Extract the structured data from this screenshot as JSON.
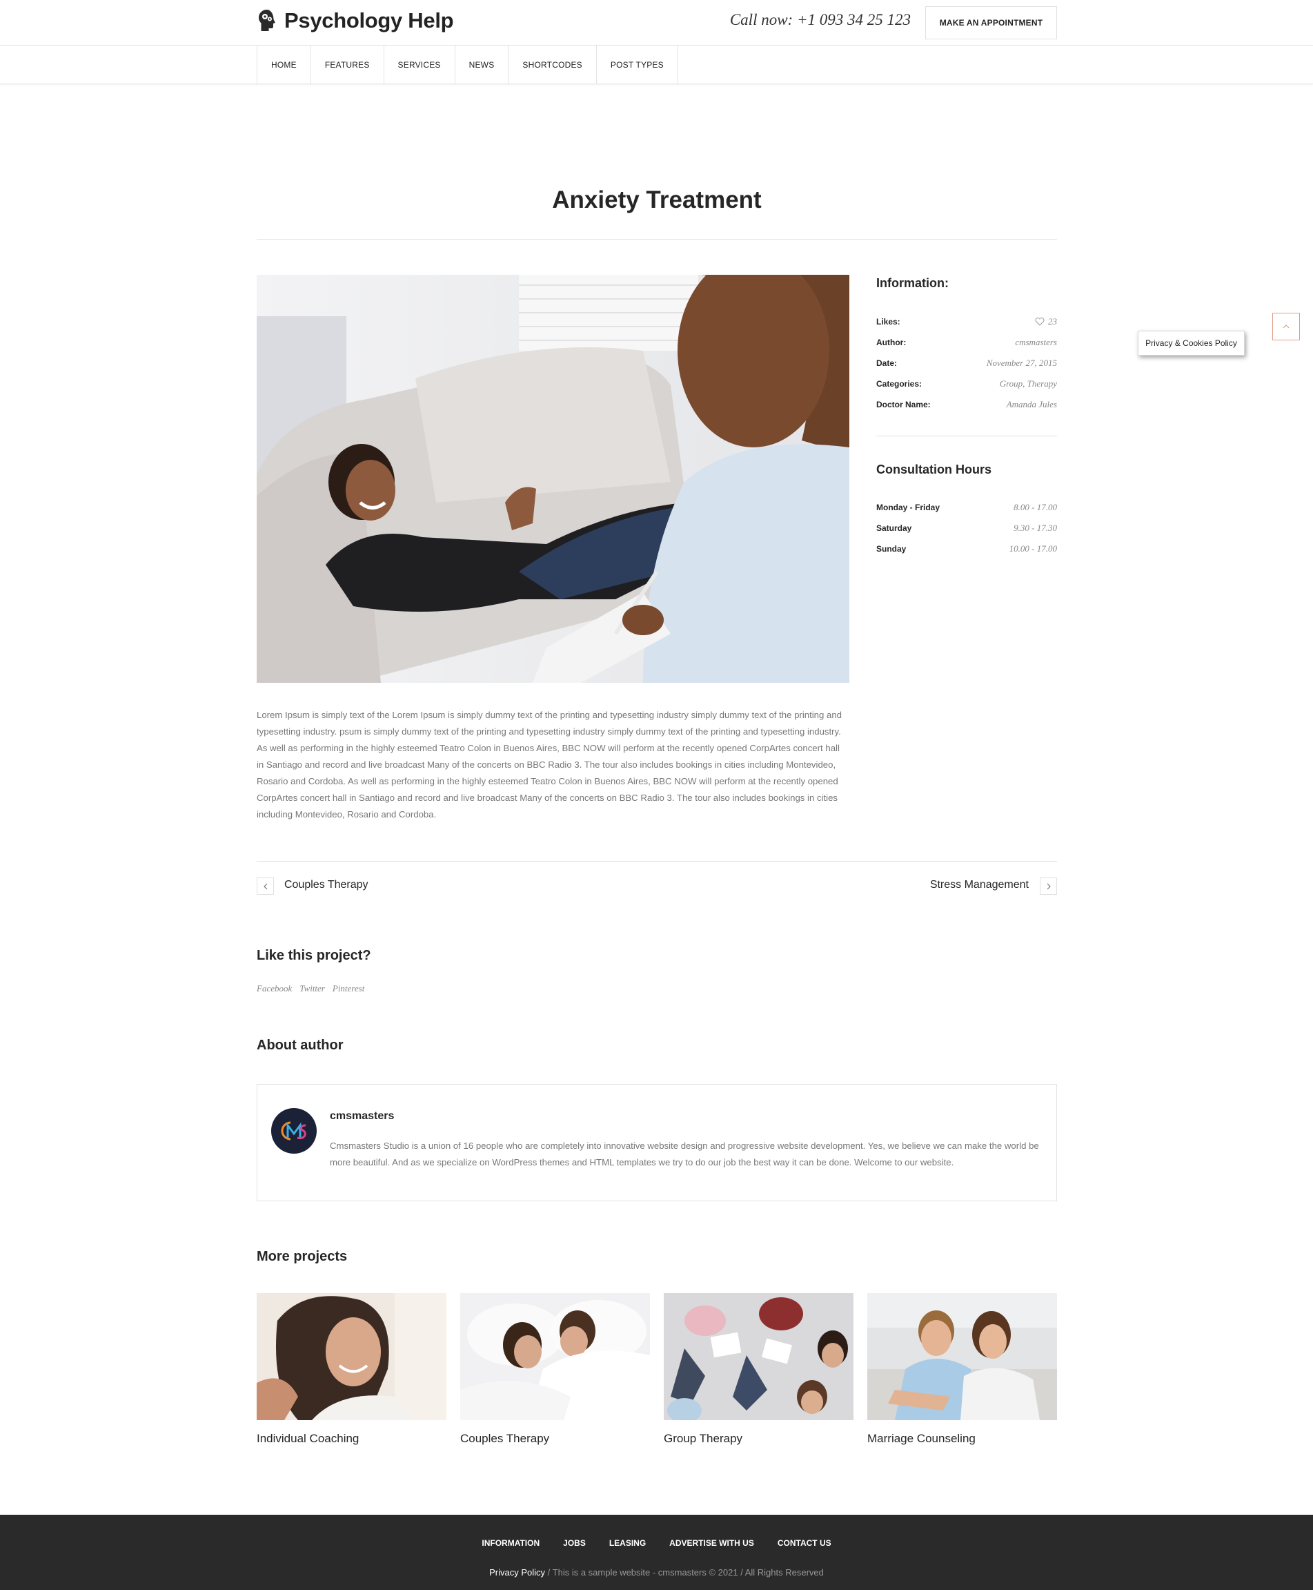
{
  "header": {
    "logo_text": "Psychology Help",
    "call_now": "Call now: +1 093 34 25 123",
    "appointment_label": "MAKE AN APPOINTMENT"
  },
  "nav": {
    "items": [
      {
        "label": "HOME"
      },
      {
        "label": "FEATURES"
      },
      {
        "label": "SERVICES"
      },
      {
        "label": "NEWS"
      },
      {
        "label": "SHORTCODES"
      },
      {
        "label": "POST TYPES"
      }
    ]
  },
  "page": {
    "title": "Anxiety Treatment",
    "body_text": "Lorem Ipsum is simply text of the Lorem Ipsum is  simply dummy text of the printing and typesetting industry simply dummy text of the printing and typesetting industry. psum is  simply dummy text of the printing and typesetting industry simply dummy text of the printing and typesetting industry.  As well as performing in the highly esteemed Teatro Colon in Buenos Aires, BBC NOW will perform at the recently opened CorpArtes concert hall in Santiago and record and live broadcast Many of the concerts on BBC Radio 3. The tour also includes bookings in cities including Montevideo, Rosario and Cordoba. As well as performing in the highly esteemed Teatro Colon in Buenos Aires, BBC NOW will perform at the recently opened CorpArtes concert hall in Santiago and record and live broadcast Many of the concerts on BBC Radio 3. The tour also includes bookings in cities including Montevideo, Rosario and Cordoba."
  },
  "information": {
    "heading": "Information:",
    "rows": [
      {
        "key": "Likes:",
        "value": "23"
      },
      {
        "key": "Author:",
        "value": "cmsmasters"
      },
      {
        "key": "Date:",
        "value": "November 27, 2015"
      },
      {
        "key": "Categories:",
        "value": "Group, Therapy"
      },
      {
        "key": "Doctor Name:",
        "value": "Amanda Jules"
      }
    ]
  },
  "consultation": {
    "heading": "Consultation Hours",
    "rows": [
      {
        "key": "Monday - Friday",
        "value": "8.00 - 17.00"
      },
      {
        "key": "Saturday",
        "value": "9.30 - 17.30"
      },
      {
        "key": "Sunday",
        "value": "10.00 - 17.00"
      }
    ]
  },
  "floating": {
    "privacy_label": "Privacy & Cookies Policy"
  },
  "pager": {
    "prev_label": "Couples Therapy",
    "next_label": "Stress Management"
  },
  "share": {
    "heading": "Like this project?",
    "links": [
      "Facebook",
      "Twitter",
      "Pinterest"
    ]
  },
  "author": {
    "heading": "About author",
    "name": "cmsmasters",
    "bio": "Cmsmasters Studio is a union of 16 people who are completely into innovative website design and progressive website development. Yes, we believe we can make the world be more beautiful. And as we specialize on WordPress themes and HTML templates we try to do our job the best way it can be done. Welcome to our website."
  },
  "more_projects": {
    "heading": "More projects",
    "items": [
      {
        "label": "Individual Coaching"
      },
      {
        "label": "Couples Therapy"
      },
      {
        "label": "Group Therapy"
      },
      {
        "label": "Marriage Counseling"
      }
    ]
  },
  "footer": {
    "links": [
      "INFORMATION",
      "JOBS",
      "LEASING",
      "ADVERTISE WITH US",
      "CONTACT US"
    ],
    "privacy_link": "Privacy Policy",
    "copyright": " / This is a sample website - cmsmasters © 2021 / All Rights Reserved"
  },
  "colors": {
    "accent": "#e29b86",
    "footer_bg": "#2a2a2a",
    "text_dark": "#262626",
    "text_muted": "#777777"
  }
}
